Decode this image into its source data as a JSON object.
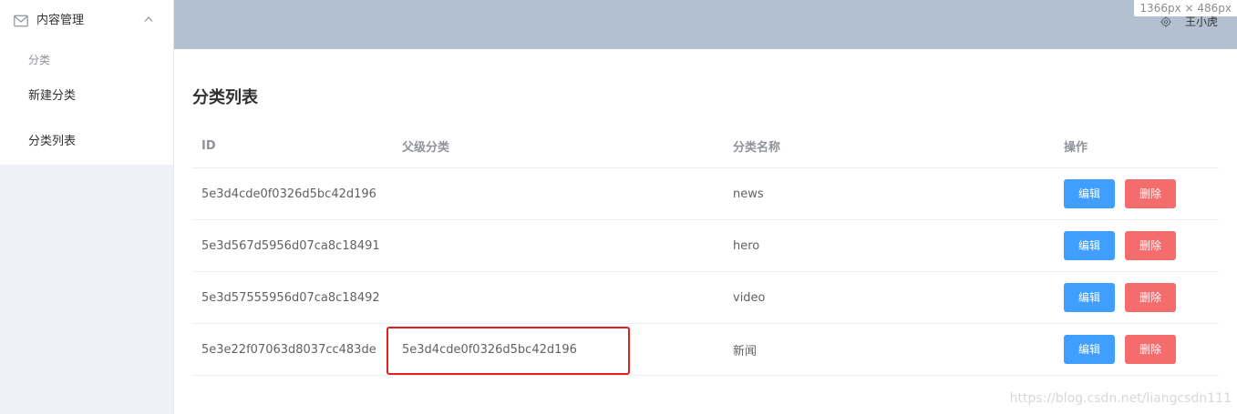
{
  "sidebar": {
    "submenu_title": "内容管理",
    "group_title": "分类",
    "items": [
      {
        "label": "新建分类"
      },
      {
        "label": "分类列表"
      }
    ]
  },
  "header": {
    "size_indicator": "1366px × 486px",
    "user_name": "王小虎"
  },
  "main": {
    "title": "分类列表",
    "table": {
      "columns": [
        "ID",
        "父级分类",
        "分类名称",
        "操作"
      ],
      "rows": [
        {
          "id": "5e3d4cde0f0326d5bc42d196",
          "parent": "",
          "name": "news",
          "edit": "编辑",
          "delete": "删除"
        },
        {
          "id": "5e3d567d5956d07ca8c18491",
          "parent": "",
          "name": "hero",
          "edit": "编辑",
          "delete": "删除"
        },
        {
          "id": "5e3d57555956d07ca8c18492",
          "parent": "",
          "name": "video",
          "edit": "编辑",
          "delete": "删除"
        },
        {
          "id": "5e3e22f07063d8037cc483de",
          "parent": "5e3d4cde0f0326d5bc42d196",
          "name": "新闻",
          "edit": "编辑",
          "delete": "删除"
        }
      ]
    }
  },
  "watermark": "https://blog.csdn.net/liangcsdn111",
  "colors": {
    "header_bg": "#b3c0d1",
    "sidebar_bg": "#eef1f6",
    "primary": "#409eff",
    "danger": "#f56c6c",
    "highlight": "#e02020"
  },
  "icons": {
    "mail": "mail-icon",
    "chevron": "chevron-up-icon",
    "gear": "gear-icon"
  }
}
